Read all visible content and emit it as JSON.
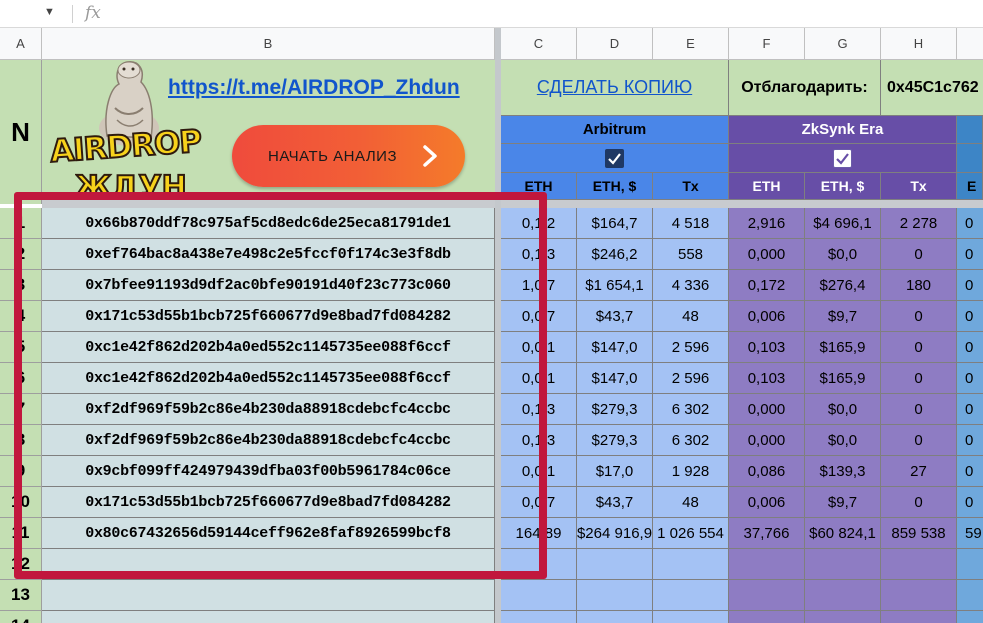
{
  "formula_bar": {
    "fx_label": "fx"
  },
  "column_headers": [
    "A",
    "B",
    "C",
    "D",
    "E",
    "F",
    "G",
    "H"
  ],
  "row_header_label": "N",
  "row_numbers": [
    "1",
    "2",
    "3",
    "4",
    "5",
    "6",
    "7",
    "8",
    "9",
    "10",
    "11",
    "12",
    "13",
    "14"
  ],
  "banner": {
    "telegram_link": "https://t.me/AIRDROP_Zhdun",
    "copy_link": "СДЕЛАТЬ КОПИЮ",
    "thanks_label": "Отблагодарить:",
    "wallet": "0x45C1c762",
    "logo_text": "AIRDROP",
    "logo_subtext": "ЖДУН",
    "start_button": "НАЧАТЬ АНАЛИЗ"
  },
  "groups": {
    "arbitrum": {
      "name": "Arbitrum",
      "checked": true,
      "color": "#4a86e8"
    },
    "zksync": {
      "name": "ZkSynk Era",
      "checked": true,
      "color": "#674ea7"
    }
  },
  "subheaders": [
    "ETH",
    "ETH, $",
    "Tx",
    "ETH",
    "ETH, $",
    "Tx",
    "E"
  ],
  "rows": [
    {
      "address": "0x66b870ddf78c975af5cd8edc6de25eca81791de1",
      "arb_eth": "0,1 2",
      "arb_usd": "$164,7",
      "arb_tx": "4 518",
      "zk_eth": "2,916",
      "zk_usd": "$4 696,1",
      "zk_tx": "2 278",
      "next": "0"
    },
    {
      "address": "0xef764bac8a438e7e498c2e5fccf0f174c3e3f8db",
      "arb_eth": "0,1 3",
      "arb_usd": "$246,2",
      "arb_tx": "558",
      "zk_eth": "0,000",
      "zk_usd": "$0,0",
      "zk_tx": "0",
      "next": "0"
    },
    {
      "address": "0x7bfee91193d9df2ac0bfe90191d40f23c773c060",
      "arb_eth": "1,0 7",
      "arb_usd": "$1 654,1",
      "arb_tx": "4 336",
      "zk_eth": "0,172",
      "zk_usd": "$276,4",
      "zk_tx": "180",
      "next": "0"
    },
    {
      "address": "0x171c53d55b1bcb725f660677d9e8bad7fd084282",
      "arb_eth": "0,0 7",
      "arb_usd": "$43,7",
      "arb_tx": "48",
      "zk_eth": "0,006",
      "zk_usd": "$9,7",
      "zk_tx": "0",
      "next": "0"
    },
    {
      "address": "0xc1e42f862d202b4a0ed552c1145735ee088f6ccf",
      "arb_eth": "0,0 1",
      "arb_usd": "$147,0",
      "arb_tx": "2 596",
      "zk_eth": "0,103",
      "zk_usd": "$165,9",
      "zk_tx": "0",
      "next": "0"
    },
    {
      "address": "0xc1e42f862d202b4a0ed552c1145735ee088f6ccf",
      "arb_eth": "0,0 1",
      "arb_usd": "$147,0",
      "arb_tx": "2 596",
      "zk_eth": "0,103",
      "zk_usd": "$165,9",
      "zk_tx": "0",
      "next": "0"
    },
    {
      "address": "0xf2df969f59b2c86e4b230da88918cdebcfc4ccbc",
      "arb_eth": "0,1 3",
      "arb_usd": "$279,3",
      "arb_tx": "6 302",
      "zk_eth": "0,000",
      "zk_usd": "$0,0",
      "zk_tx": "0",
      "next": "0"
    },
    {
      "address": "0xf2df969f59b2c86e4b230da88918cdebcfc4ccbc",
      "arb_eth": "0,1 3",
      "arb_usd": "$279,3",
      "arb_tx": "6 302",
      "zk_eth": "0,000",
      "zk_usd": "$0,0",
      "zk_tx": "0",
      "next": "0"
    },
    {
      "address": "0x9cbf099ff424979439dfba03f00b5961784c06ce",
      "arb_eth": "0,0 1",
      "arb_usd": "$17,0",
      "arb_tx": "1 928",
      "zk_eth": "0,086",
      "zk_usd": "$139,3",
      "zk_tx": "27",
      "next": "0"
    },
    {
      "address": "0x171c53d55b1bcb725f660677d9e8bad7fd084282",
      "arb_eth": "0,0 7",
      "arb_usd": "$43,7",
      "arb_tx": "48",
      "zk_eth": "0,006",
      "zk_usd": "$9,7",
      "zk_tx": "0",
      "next": "0"
    },
    {
      "address": "0x80c67432656d59144ceff962e8faf8926599bcf8",
      "arb_eth": "164,89",
      "arb_usd": "$264 916,9",
      "arb_tx": "1 026 554",
      "zk_eth": "37,766",
      "zk_usd": "$60 824,1",
      "zk_tx": "859 538",
      "next": "59"
    }
  ],
  "colors": {
    "row_header_green": "#c4dfb3",
    "address_cell": "#d0e0e3",
    "arbitrum_cell": "#a4c2f4",
    "zksync_cell": "#8e7cc3",
    "highlight_frame": "#c1173d",
    "start_button_gradient": [
      "#ef4b3c",
      "#f47b2a"
    ]
  },
  "icons": {
    "checkbox": "checked-box-icon",
    "start_chevron": "chevron-right-icon",
    "mascot": "mascot-illustration"
  }
}
